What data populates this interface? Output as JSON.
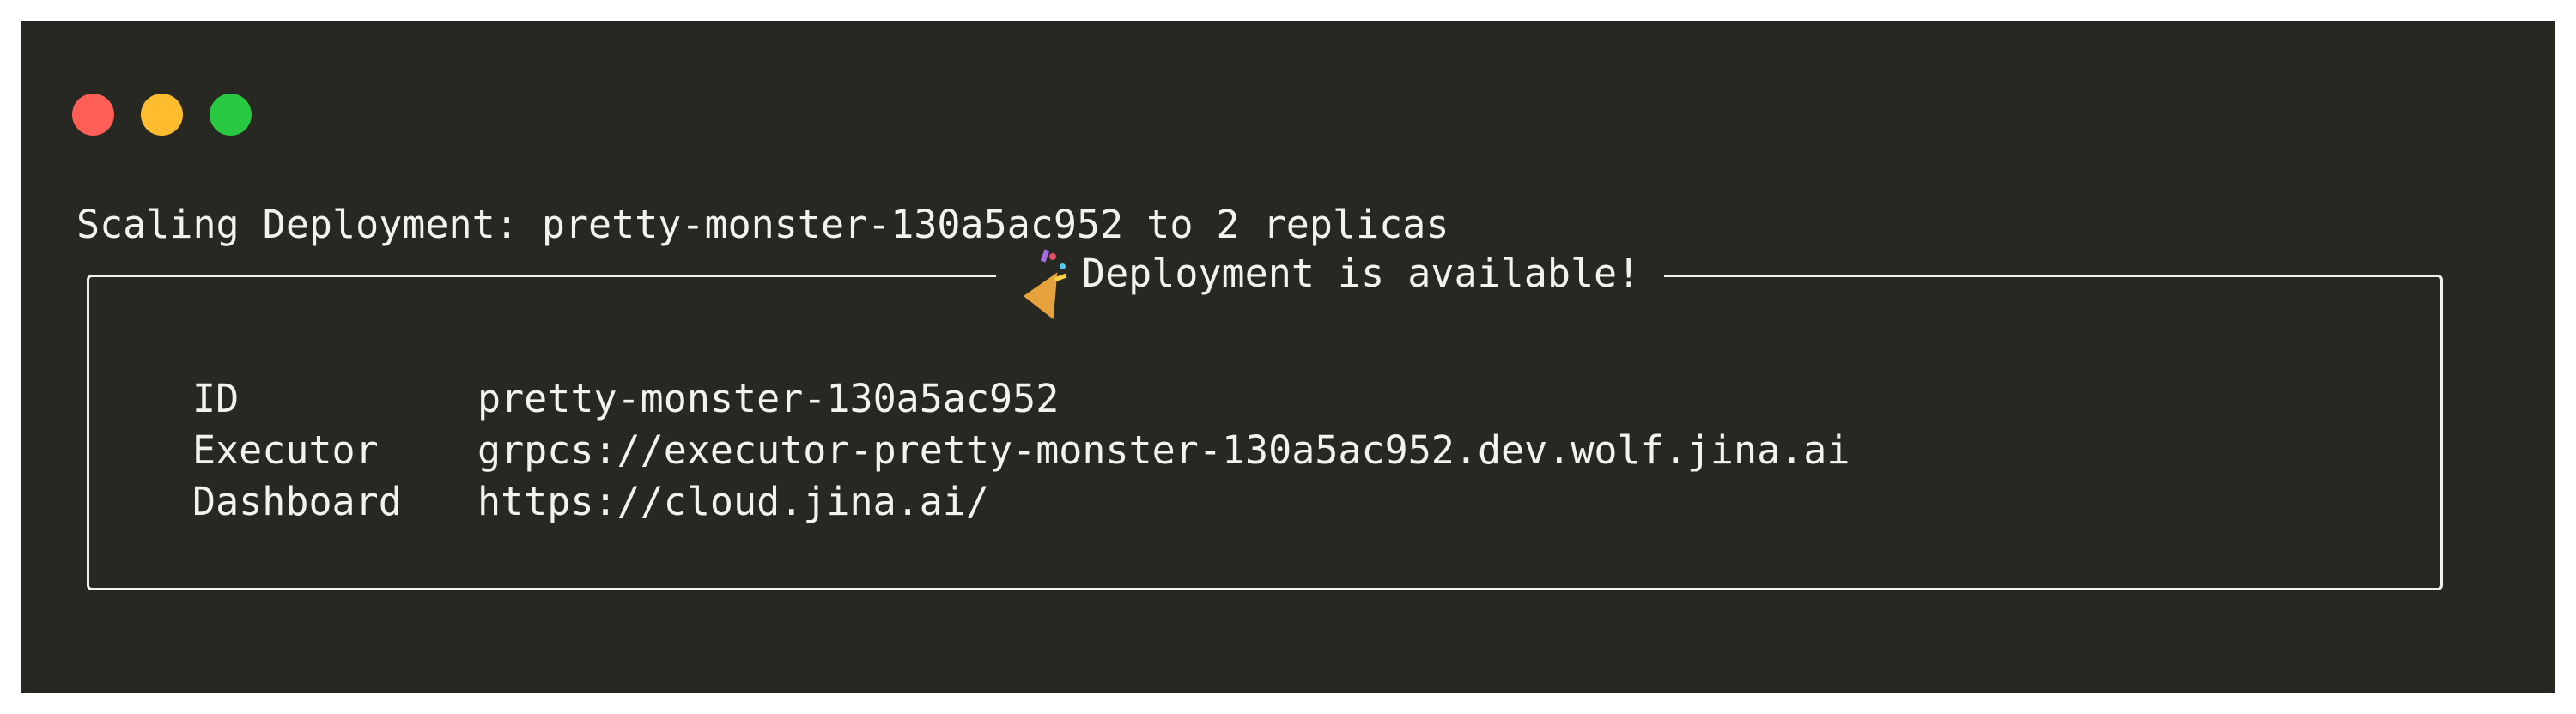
{
  "window": {
    "controls": [
      "close",
      "minimize",
      "maximize"
    ],
    "colors": {
      "background": "#272822",
      "text": "#f2f2ef",
      "close": "#ff5f57",
      "minimize": "#febc2e",
      "maximize": "#28c840"
    }
  },
  "terminal": {
    "scaling_line": "Scaling Deployment: pretty-monster-130a5ac952 to 2 replicas",
    "panel": {
      "title_icon": "party-popper-icon",
      "title": "Deployment is available!",
      "rows": [
        {
          "key": "ID",
          "value": "pretty-monster-130a5ac952"
        },
        {
          "key": "Executor",
          "value": "grpcs://executor-pretty-monster-130a5ac952.dev.wolf.jina.ai"
        },
        {
          "key": "Dashboard",
          "value": "https://cloud.jina.ai/"
        }
      ]
    }
  }
}
